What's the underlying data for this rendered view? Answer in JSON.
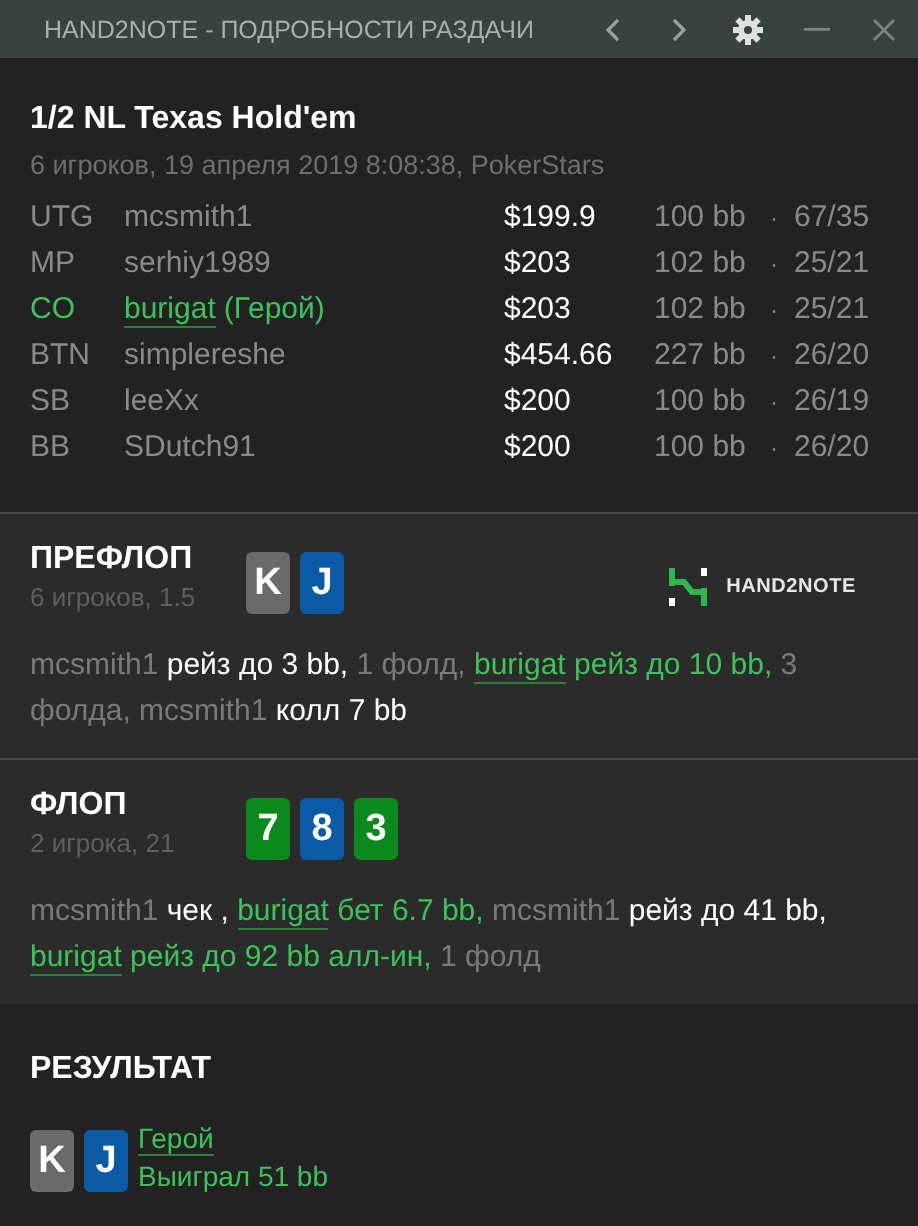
{
  "window": {
    "title": "HAND2NOTE - ПОДРОБНОСТИ РАЗДАЧИ"
  },
  "hand": {
    "title": "1/2 NL Texas Hold'em",
    "subtitle": "6 игроков, 19 апреля 2019 8:08:38, PokerStars"
  },
  "players": [
    {
      "position": "UTG",
      "name": "mcsmith1",
      "hero": false,
      "stack": "$199.9",
      "bb": "100 bb",
      "separator": "·",
      "stats": "67/35"
    },
    {
      "position": "MP",
      "name": "serhiy1989",
      "hero": false,
      "stack": "$203",
      "bb": "102 bb",
      "separator": "·",
      "stats": "25/21"
    },
    {
      "position": "CO",
      "name": "burigat",
      "hero": true,
      "hero_label": "(Герой)",
      "stack": "$203",
      "bb": "102 bb",
      "separator": "·",
      "stats": "25/21"
    },
    {
      "position": "BTN",
      "name": "simplereshe",
      "hero": false,
      "stack": "$454.66",
      "bb": "227 bb",
      "separator": "·",
      "stats": "26/20"
    },
    {
      "position": "SB",
      "name": "leeXx",
      "hero": false,
      "stack": "$200",
      "bb": "100 bb",
      "separator": "·",
      "stats": "26/19"
    },
    {
      "position": "BB",
      "name": "SDutch91",
      "hero": false,
      "stack": "$200",
      "bb": "100 bb",
      "separator": "·",
      "stats": "26/20"
    }
  ],
  "streets": [
    {
      "title": "ПРЕФЛОП",
      "subtitle": "6 игроков, 1.5",
      "logo": "HAND2NOTE",
      "cards": [
        {
          "rank": "K",
          "color": "#6a6a6a"
        },
        {
          "rank": "J",
          "color": "#0b5aa6"
        }
      ],
      "actions": [
        {
          "text": "mcsmith1",
          "kind": "name",
          "hero": false
        },
        {
          "text": "рейз до 3 bb,",
          "kind": "action",
          "hero": false
        },
        {
          "text": "1 фолд,",
          "kind": "other",
          "hero": false
        },
        {
          "text": "burigat",
          "kind": "name",
          "hero": true
        },
        {
          "text": "рейз до 10 bb,",
          "kind": "action",
          "hero": true
        },
        {
          "text": "3 фолда,",
          "kind": "other",
          "hero": false
        },
        {
          "text": "mcsmith1",
          "kind": "name",
          "hero": false
        },
        {
          "text": "колл 7 bb",
          "kind": "action",
          "hero": false
        }
      ]
    },
    {
      "title": "ФЛОП",
      "subtitle": "2 игрока, 21",
      "cards": [
        {
          "rank": "7",
          "color": "#0a8a1c"
        },
        {
          "rank": "8",
          "color": "#0b5aa6"
        },
        {
          "rank": "3",
          "color": "#0a8a1c"
        }
      ],
      "actions": [
        {
          "text": "mcsmith1",
          "kind": "name",
          "hero": false
        },
        {
          "text": "чек ,",
          "kind": "action",
          "hero": false
        },
        {
          "text": "burigat",
          "kind": "name",
          "hero": true
        },
        {
          "text": "бет 6.7 bb,",
          "kind": "action",
          "hero": true
        },
        {
          "text": "mcsmith1",
          "kind": "name",
          "hero": false
        },
        {
          "text": "рейз до 41 bb,",
          "kind": "action",
          "hero": false
        },
        {
          "text": "burigat",
          "kind": "name",
          "hero": true
        },
        {
          "text": "рейз до 92 bb алл-ин,",
          "kind": "action",
          "hero": true
        },
        {
          "text": "1 фолд",
          "kind": "other",
          "hero": false
        }
      ]
    }
  ],
  "result": {
    "title": "РЕЗУЛЬТАТ",
    "cards": [
      {
        "rank": "K",
        "color": "#6a6a6a"
      },
      {
        "rank": "J",
        "color": "#0b5aa6"
      }
    ],
    "player": "Герой",
    "outcome": "Выиграл 51 bb"
  }
}
